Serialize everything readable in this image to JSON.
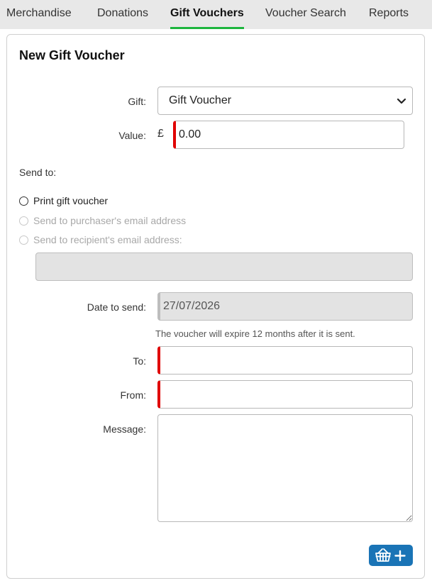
{
  "tabs": [
    {
      "label": "Merchandise",
      "active": false
    },
    {
      "label": "Donations",
      "active": false
    },
    {
      "label": "Gift Vouchers",
      "active": true
    },
    {
      "label": "Voucher Search",
      "active": false
    },
    {
      "label": "Reports",
      "active": false
    }
  ],
  "form": {
    "title": "New Gift Voucher",
    "gift": {
      "label": "Gift:",
      "selected": "Gift Voucher"
    },
    "value": {
      "label": "Value:",
      "currency_symbol": "£",
      "value": "0.00"
    },
    "send_to_label": "Send to:",
    "send_options": [
      {
        "label": "Print gift voucher",
        "enabled": true,
        "checked": false
      },
      {
        "label": "Send to purchaser's email address",
        "enabled": false,
        "checked": false
      },
      {
        "label": "Send to recipient's email address:",
        "enabled": false,
        "checked": false
      }
    ],
    "recipient_email": {
      "value": ""
    },
    "date_to_send": {
      "label": "Date to send:",
      "value": "27/07/2026"
    },
    "expiry_hint": "The voucher will expire 12 months after it is sent.",
    "to": {
      "label": "To:",
      "value": ""
    },
    "from": {
      "label": "From:",
      "value": ""
    },
    "message": {
      "label": "Message:",
      "value": ""
    },
    "add_button": {
      "icon": "basket-plus-icon",
      "color": "#1a74b6"
    }
  },
  "colors": {
    "accent_tab": "#1db53e",
    "required_marker": "#e00000"
  }
}
